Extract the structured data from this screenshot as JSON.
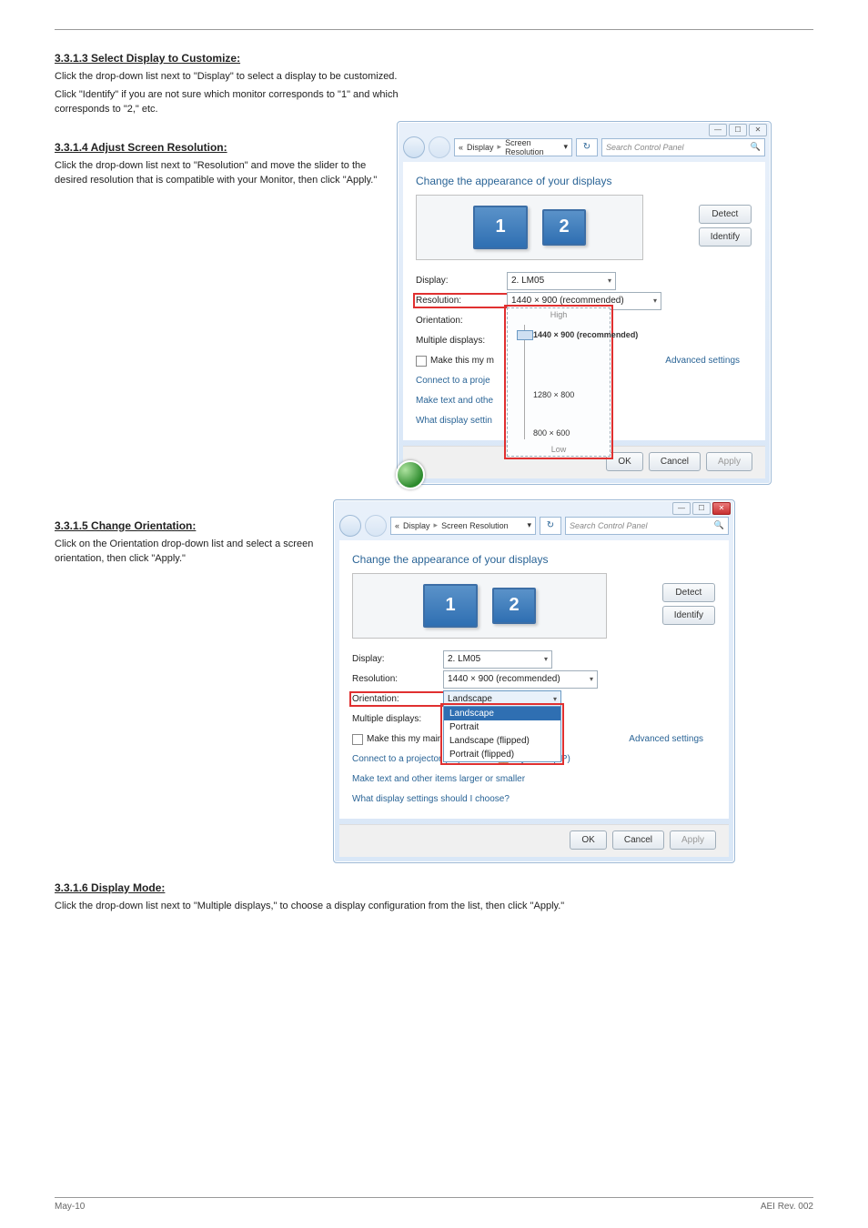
{
  "running_header": {
    "left": "",
    "right": ""
  },
  "sections": {
    "select_display": {
      "title": "3.3.1.3 Select Display to Customize:",
      "p1": "Click the drop-down list next to \"Display\" to select a display to be customized.",
      "p2": "Click \"Identify\" if you are not sure which monitor corresponds to \"1\" and which corresponds to \"2,\" etc."
    },
    "adjust_resolution": {
      "title": "3.3.1.4 Adjust Screen Resolution:",
      "p1": "Click the drop-down list next to \"Resolution\" and move the slider to the desired resolution that is compatible with your Monitor, then click \"Apply.\""
    },
    "change_orientation": {
      "title": "3.3.1.5 Change Orientation:",
      "p1": "Click on the Orientation drop-down list and select a screen orientation, then click \"Apply.\""
    },
    "display_mode": {
      "title": "3.3.1.6 Display Mode:",
      "p1": "Click the drop-down list next to \"Multiple displays,\" to choose a display configuration from the list, then click \"Apply.\""
    }
  },
  "win": {
    "breadcrumb": {
      "prefix": "«",
      "display": "Display",
      "screen": "Screen Resolution"
    },
    "search_placeholder": "Search Control Panel",
    "heading": "Change the appearance of your displays",
    "detect": "Detect",
    "identify": "Identify",
    "labels": {
      "display": "Display:",
      "resolution": "Resolution:",
      "orientation": "Orientation:",
      "multiple": "Multiple displays:"
    },
    "values": {
      "display": "2. LM05",
      "resolution": "1440 × 900 (recommended)",
      "orientation": "Landscape"
    },
    "resolution_slider": {
      "high": "High",
      "low": "Low",
      "options": {
        "recommended": "1440 × 900 (recommended)",
        "mid": "1280 × 800",
        "bottom": "800 × 600"
      }
    },
    "orientation_options": {
      "landscape": "Landscape",
      "portrait": "Portrait",
      "landscape_flipped": "Landscape (flipped)",
      "portrait_flipped": "Portrait (flipped)"
    },
    "make_main_short": "Make this my m",
    "make_main_long": "Make this my main display",
    "connect_projector_short": "Connect to a proje",
    "connect_projector_full": "Connect to a projector (or press the 🪟 key and tap P)",
    "make_text_short": "Make text and othe",
    "make_text_full": "Make text and other items larger or smaller",
    "what_settings_short": "What display settin",
    "what_settings_full": "What display settings should I choose?",
    "advanced": "Advanced settings",
    "ok": "OK",
    "cancel": "Cancel",
    "apply": "Apply"
  },
  "footer": {
    "left": "May-10",
    "right": "AEI Rev. 002"
  }
}
